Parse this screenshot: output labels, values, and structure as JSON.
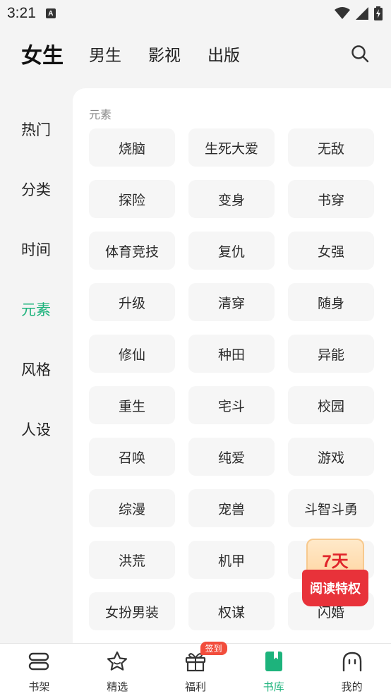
{
  "status_bar": {
    "time": "3:21",
    "notification_letter": "A"
  },
  "top_tabs": [
    {
      "label": "女生",
      "active": true
    },
    {
      "label": "男生"
    },
    {
      "label": "影视"
    },
    {
      "label": "出版"
    }
  ],
  "search": {
    "icon": "search-icon"
  },
  "side_nav": [
    {
      "label": "热门"
    },
    {
      "label": "分类"
    },
    {
      "label": "时间"
    },
    {
      "label": "元素",
      "active": true
    },
    {
      "label": "风格"
    },
    {
      "label": "人设"
    }
  ],
  "section": {
    "title": "元素",
    "tags": [
      "烧脑",
      "生死大爱",
      "无敌",
      "探险",
      "变身",
      "书穿",
      "体育竞技",
      "复仇",
      "女强",
      "升级",
      "清穿",
      "随身",
      "修仙",
      "种田",
      "异能",
      "重生",
      "宅斗",
      "校园",
      "召唤",
      "纯爱",
      "游戏",
      "综漫",
      "宠兽",
      "斗智斗勇",
      "洪荒",
      "机甲",
      "",
      "女扮男装",
      "权谋",
      "闪婚"
    ]
  },
  "promo": {
    "days": "7天",
    "text": "阅读特权"
  },
  "bottom_nav": [
    {
      "label": "书架",
      "icon": "bookshelf-icon"
    },
    {
      "label": "精选",
      "icon": "star-icon"
    },
    {
      "label": "福利",
      "icon": "gift-icon",
      "badge": "签到"
    },
    {
      "label": "书库",
      "icon": "book-library-icon",
      "active": true
    },
    {
      "label": "我的",
      "icon": "profile-icon"
    }
  ],
  "colors": {
    "accent": "#1db37c",
    "badge": "#f24d3c",
    "promo_red": "#e8323a"
  }
}
